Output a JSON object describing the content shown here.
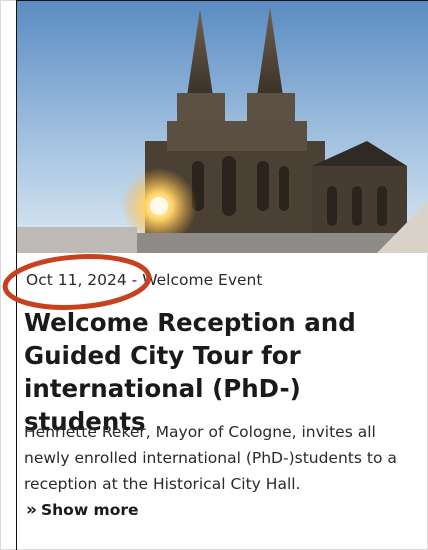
{
  "article": {
    "date": "Oct 11, 2024",
    "separator": " - ",
    "category": "Welcome Event",
    "title": "Welcome Reception and Guided City Tour for international (PhD-) students",
    "description": "Henriette Reker, Mayor of Cologne, invites all newly enrolled international (PhD-)students to a reception at the Historical City Hall.",
    "show_more_label": "Show more",
    "show_more_icon": "double-chevron-right-icon",
    "image_subject": "cologne-cathedral-image"
  },
  "colors": {
    "annotation_ellipse": "#c8411f",
    "text_primary": "#1a1a1a",
    "sky_top": "#5f8fc4",
    "sky_bottom": "#cfe0ee"
  }
}
